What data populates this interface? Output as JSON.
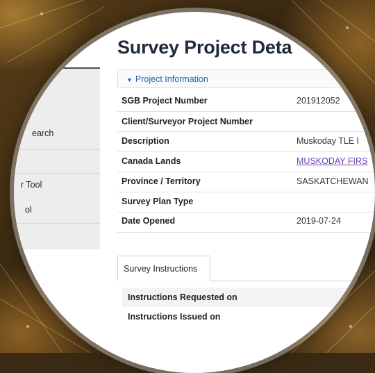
{
  "sidebar": {
    "items": [
      {
        "label": ""
      },
      {
        "label": "earch"
      },
      {
        "label": ""
      },
      {
        "label": "r Tool"
      },
      {
        "label": "ol"
      }
    ]
  },
  "page": {
    "title": "Survey Project Deta"
  },
  "project_info": {
    "section_label": "Project Information",
    "toggle_glyph": "▼",
    "rows": [
      {
        "label": "SGB Project Number",
        "value": "201912052"
      },
      {
        "label": "Client/Surveyor Project Number",
        "value": ""
      },
      {
        "label": "Description",
        "value": "Muskoday TLE l"
      },
      {
        "label": "Canada Lands",
        "value": "MUSKODAY FIRS"
      },
      {
        "label": "Province / Territory",
        "value": "SASKATCHEWAN"
      },
      {
        "label": "Survey Plan Type",
        "value": ""
      },
      {
        "label": "Date Opened",
        "value": "2019-07-24"
      }
    ]
  },
  "instructions": {
    "tab_label": "Survey Instructions",
    "rows": [
      {
        "label": "Instructions Requested on"
      },
      {
        "label": "Instructions Issued on"
      }
    ]
  },
  "colors": {
    "link": "#2a63b8",
    "visited_link": "#6b3fb3",
    "title": "#1f2a3a"
  }
}
